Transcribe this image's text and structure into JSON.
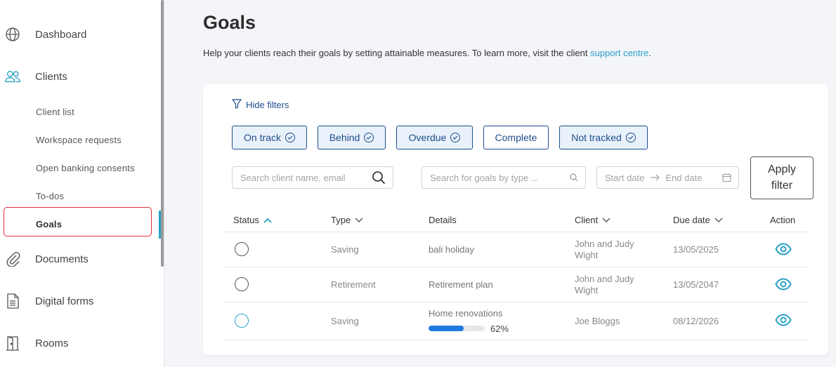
{
  "sidebar": {
    "nav": [
      {
        "label": "Dashboard",
        "icon": "globe-icon"
      },
      {
        "label": "Clients",
        "icon": "users-icon"
      },
      {
        "label": "Documents",
        "icon": "paperclip-icon"
      },
      {
        "label": "Digital forms",
        "icon": "form-icon"
      },
      {
        "label": "Rooms",
        "icon": "door-icon"
      }
    ],
    "sub_items": [
      "Client list",
      "Workspace requests",
      "Open banking consents",
      "To-dos",
      "Goals"
    ],
    "active_item": "Goals"
  },
  "page": {
    "title": "Goals",
    "intro_text": "Help your clients reach their goals by setting attainable measures. To learn more, visit the client ",
    "intro_link": "support centre",
    "intro_end": "."
  },
  "filters": {
    "toggle_label": "Hide filters",
    "chips": [
      {
        "label": "On track",
        "selected": true
      },
      {
        "label": "Behind",
        "selected": true
      },
      {
        "label": "Overdue",
        "selected": true
      },
      {
        "label": "Complete",
        "selected": false
      },
      {
        "label": "Not tracked",
        "selected": true
      }
    ],
    "client_search_placeholder": "Search client name, email",
    "goal_search_placeholder": "Search for goals by type ...",
    "start_date_placeholder": "Start date",
    "end_date_placeholder": "End date",
    "apply_label_line1": "Apply",
    "apply_label_line2": "filter"
  },
  "table": {
    "headers": [
      "Status",
      "Type",
      "Details",
      "Client",
      "Due date",
      "Action"
    ],
    "rows": [
      {
        "type": "Saving",
        "details": "bali holiday",
        "client_line1": "John and Judy",
        "client_line2": "Wight",
        "due": "13/05/2025",
        "status_color": "#555555"
      },
      {
        "type": "Retirement",
        "details": "Retirement plan",
        "client_line1": "John and Judy",
        "client_line2": "Wight",
        "due": "13/05/2047",
        "status_color": "#555555"
      },
      {
        "type": "Saving",
        "details": "Home renovations",
        "client_line1": "Joe Bloggs",
        "client_line2": "",
        "due": "08/12/2026",
        "status_color": "#2aa0c6",
        "progress": 62,
        "progress_label": "62%"
      }
    ]
  },
  "colors": {
    "accent": "#2aa0c6",
    "chip": "#1e4d8c",
    "highlight": "#e0313a",
    "progress": "#1f7ae0"
  }
}
